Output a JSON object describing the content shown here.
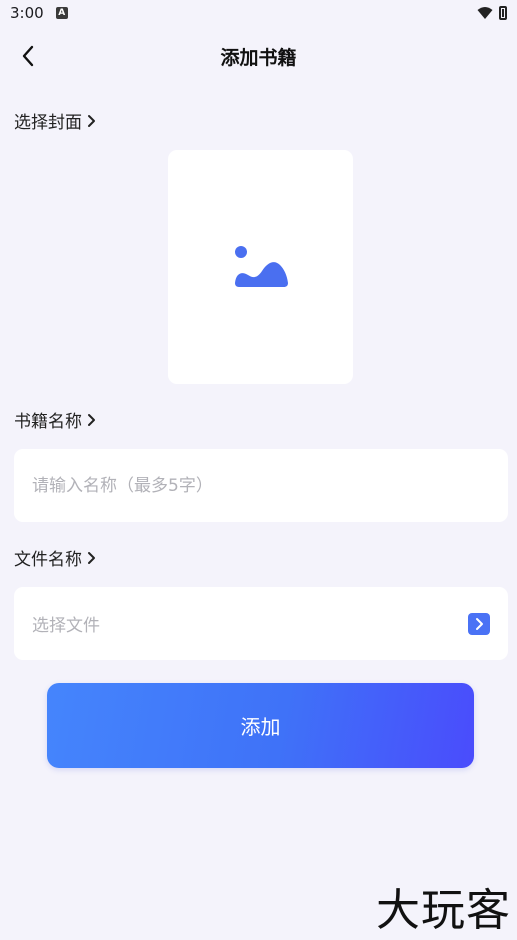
{
  "status_bar": {
    "time": "3:00",
    "notification_icon": "a-icon"
  },
  "header": {
    "title": "添加书籍",
    "back_icon": "chevron-left-icon"
  },
  "cover": {
    "label": "选择封面",
    "image_icon": "image-placeholder-icon"
  },
  "book_name": {
    "label": "书籍名称",
    "placeholder": "请输入名称（最多5字）",
    "value": ""
  },
  "file_name": {
    "label": "文件名称",
    "placeholder": "选择文件"
  },
  "submit": {
    "label": "添加"
  },
  "colors": {
    "accent": "#4a72f5",
    "background": "#f4f3fb",
    "card": "#ffffff"
  },
  "watermark": {
    "text": "大玩客"
  }
}
